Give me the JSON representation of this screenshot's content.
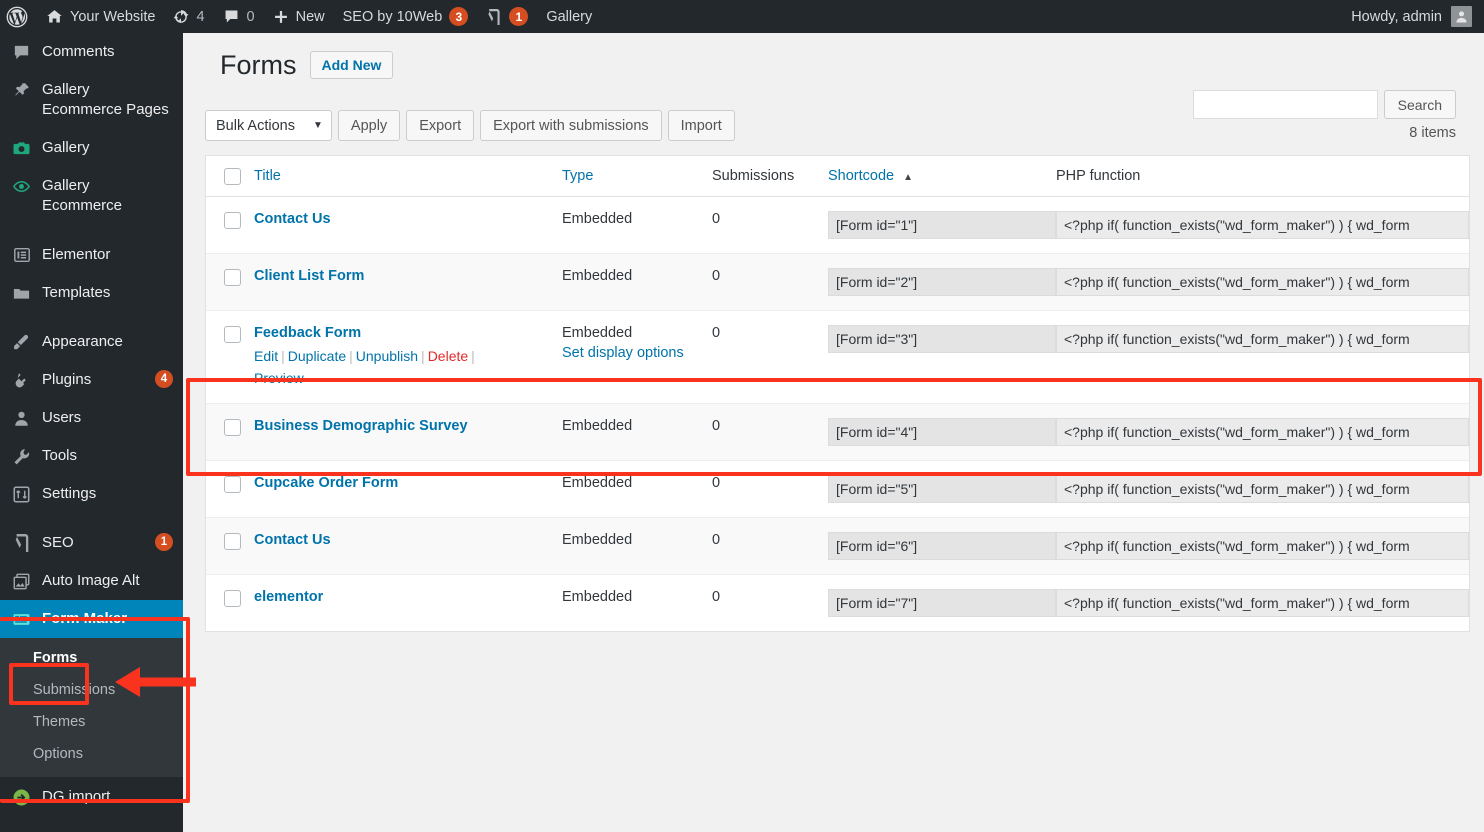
{
  "adminbar": {
    "logo_icon": "wordpress-logo-icon",
    "site_icon": "home-icon",
    "site_name": "Your Website",
    "updates_icon": "updates-icon",
    "updates_count": "4",
    "comments_icon": "comment-bubble-icon",
    "comments_count": "0",
    "new_icon": "plus-icon",
    "new_label": "New",
    "seo_label": "SEO by 10Web",
    "seo_badge": "3",
    "yoast_icon": "yoast-icon",
    "yoast_badge": "1",
    "gallery_label": "Gallery",
    "howdy": "Howdy, admin",
    "avatar_icon": "user-avatar-icon"
  },
  "sidebar": {
    "items": [
      {
        "label": "Comments",
        "icon": "comment-bubble-icon",
        "badge": ""
      },
      {
        "label": "Gallery Ecommerce Pages",
        "icon": "pin-icon",
        "badge": ""
      },
      {
        "label": "Gallery",
        "icon": "camera-icon",
        "badge": ""
      },
      {
        "label": "Gallery Ecommerce",
        "icon": "eye-icon",
        "badge": ""
      },
      {
        "label": "Elementor",
        "icon": "elementor-icon",
        "badge": ""
      },
      {
        "label": "Templates",
        "icon": "folder-icon",
        "badge": ""
      },
      {
        "label": "Appearance",
        "icon": "paintbrush-icon",
        "badge": ""
      },
      {
        "label": "Plugins",
        "icon": "plug-icon",
        "badge": "4"
      },
      {
        "label": "Users",
        "icon": "user-icon",
        "badge": ""
      },
      {
        "label": "Tools",
        "icon": "wrench-icon",
        "badge": ""
      },
      {
        "label": "Settings",
        "icon": "sliders-icon",
        "badge": ""
      },
      {
        "label": "SEO",
        "icon": "yoast-icon",
        "badge": "1"
      },
      {
        "label": "Auto Image Alt",
        "icon": "images-icon",
        "badge": ""
      }
    ],
    "active": {
      "label": "Form Maker",
      "icon": "form-maker-icon"
    },
    "submenu": [
      {
        "label": "Forms",
        "current": true
      },
      {
        "label": "Submissions",
        "current": false
      },
      {
        "label": "Themes",
        "current": false
      },
      {
        "label": "Options",
        "current": false
      }
    ],
    "bottom_item": {
      "label": "DG import",
      "icon": "import-arrow-icon"
    }
  },
  "page": {
    "title": "Forms",
    "add_new_label": "Add New"
  },
  "search": {
    "value": "",
    "placeholder": "",
    "button_label": "Search",
    "item_count": "8 items"
  },
  "toolbar": {
    "bulk_actions_label": "Bulk Actions",
    "caret_icon": "chevron-down-icon",
    "apply_label": "Apply",
    "export_label": "Export",
    "export_submissions_label": "Export with submissions",
    "import_label": "Import"
  },
  "table": {
    "columns": {
      "title": "Title",
      "type": "Type",
      "submissions": "Submissions",
      "shortcode": "Shortcode",
      "php_function": "PHP function"
    },
    "sort_arrow_icon": "sort-asc-arrow-icon",
    "php_function_value": "<?php if( function_exists(\"wd_form_maker\") ) { wd_form",
    "rows": [
      {
        "title": "Contact Us",
        "type": "Embedded",
        "submissions": "0",
        "shortcode": "[Form id=\"1\"]",
        "hovered": false
      },
      {
        "title": "Client List Form",
        "type": "Embedded",
        "submissions": "0",
        "shortcode": "[Form id=\"2\"]",
        "hovered": false
      },
      {
        "title": "Feedback Form",
        "type": "Embedded",
        "submissions": "0",
        "shortcode": "[Form id=\"3\"]",
        "hovered": true
      },
      {
        "title": "Business Demographic Survey",
        "type": "Embedded",
        "submissions": "0",
        "shortcode": "[Form id=\"4\"]",
        "hovered": false
      },
      {
        "title": "Cupcake Order Form",
        "type": "Embedded",
        "submissions": "0",
        "shortcode": "[Form id=\"5\"]",
        "hovered": false
      },
      {
        "title": "Contact Us",
        "type": "Embedded",
        "submissions": "0",
        "shortcode": "[Form id=\"6\"]",
        "hovered": false
      },
      {
        "title": "elementor",
        "type": "Embedded",
        "submissions": "0",
        "shortcode": "[Form id=\"7\"]",
        "hovered": false
      }
    ],
    "row_actions": {
      "edit": "Edit",
      "duplicate": "Duplicate",
      "unpublish": "Unpublish",
      "delete": "Delete",
      "preview": "Preview",
      "set_display_options": "Set display options"
    }
  },
  "annotations": {
    "color": "#f9331d",
    "highlight_row_title": "Feedback Form",
    "highlight_menu": "Form Maker",
    "highlight_submenu": "Forms"
  }
}
